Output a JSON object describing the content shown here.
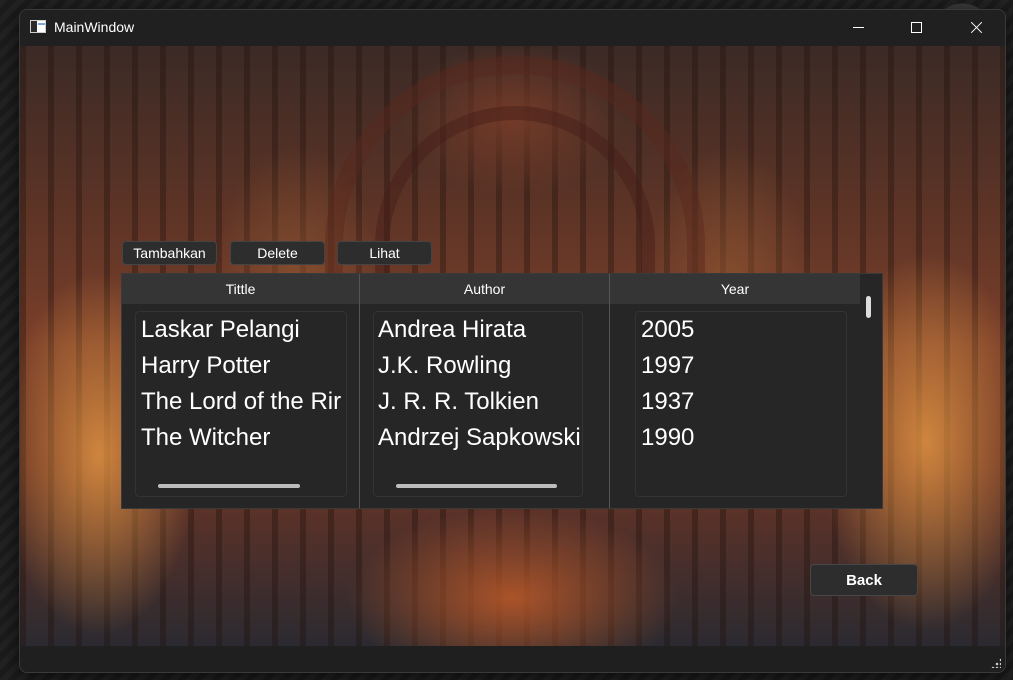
{
  "window": {
    "title": "MainWindow",
    "controls": [
      "minimize-icon",
      "maximize-icon",
      "close-icon"
    ]
  },
  "toolbar": {
    "tambahkan_label": "Tambahkan",
    "delete_label": "Delete",
    "lihat_label": "Lihat"
  },
  "table": {
    "columns": [
      "Tittle",
      "Author",
      "Year"
    ],
    "rows": [
      {
        "title": "Laskar Pelangi",
        "author": "Andrea Hirata",
        "year": "2005"
      },
      {
        "title": "Harry Potter",
        "author": "J.K. Rowling",
        "year": "1997"
      },
      {
        "title": "The Lord of the Rir",
        "author": "J. R. R. Tolkien",
        "year": "1937"
      },
      {
        "title": "The Witcher",
        "author": "Andrzej Sapkowski",
        "year": "1990"
      }
    ]
  },
  "footer": {
    "back_label": "Back"
  },
  "colors": {
    "window_bg": "#202020",
    "button_bg": "#2d2d2d",
    "header_bg": "#353535",
    "table_bg": "#262626"
  }
}
